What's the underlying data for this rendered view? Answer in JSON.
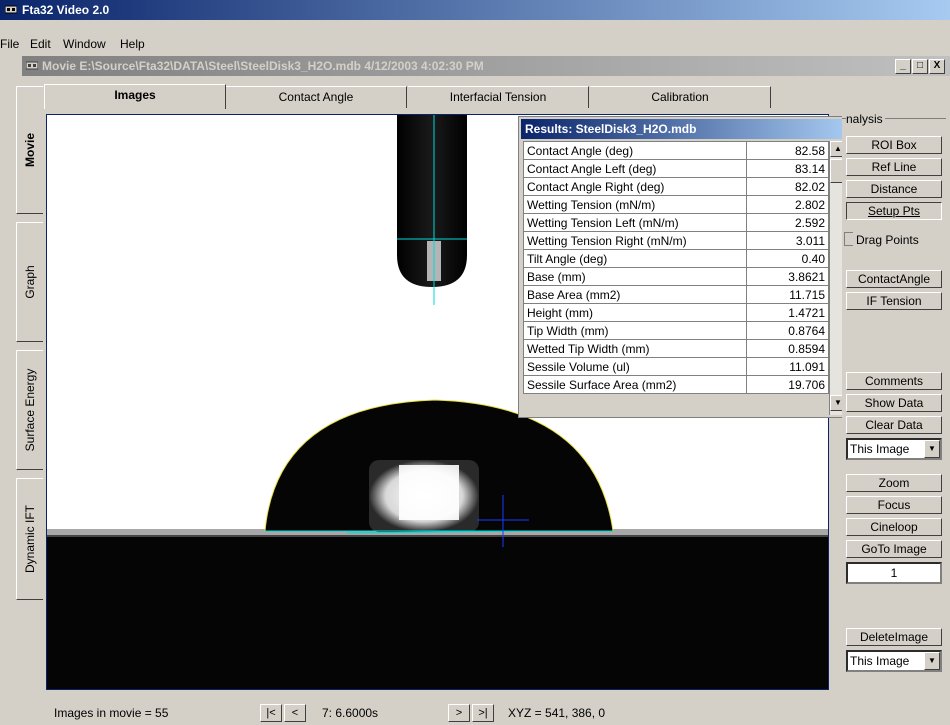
{
  "app": {
    "title": "Fta32 Video 2.0"
  },
  "menu": [
    "File",
    "Edit",
    "Window",
    "Help"
  ],
  "child_window": {
    "title": "Movie E:\\Source\\Fta32\\DATA\\Steel\\SteelDisk3_H2O.mdb 4/12/2003 4:02:30 PM",
    "minimize": "_",
    "restore": "□",
    "close": "X"
  },
  "left_tabs": [
    "Movie",
    "Graph",
    "Surface Energy",
    "Dynamic IFT"
  ],
  "top_tabs": [
    "Images",
    "Contact Angle",
    "Interfacial Tension",
    "Calibration"
  ],
  "results": {
    "title": "Results: SteelDisk3_H2O.mdb",
    "rows": [
      {
        "label": "Contact Angle (deg)",
        "value": "82.58"
      },
      {
        "label": "Contact Angle Left (deg)",
        "value": "83.14"
      },
      {
        "label": "Contact Angle Right (deg)",
        "value": "82.02"
      },
      {
        "label": "Wetting Tension (mN/m)",
        "value": "2.802"
      },
      {
        "label": "Wetting Tension Left (mN/m)",
        "value": "2.592"
      },
      {
        "label": "Wetting Tension Right (mN/m)",
        "value": "3.011"
      },
      {
        "label": "Tilt Angle (deg)",
        "value": "0.40"
      },
      {
        "label": "Base (mm)",
        "value": "3.8621"
      },
      {
        "label": "Base Area (mm2)",
        "value": "11.715"
      },
      {
        "label": "Height (mm)",
        "value": "1.4721"
      },
      {
        "label": "Tip Width (mm)",
        "value": "0.8764"
      },
      {
        "label": "Wetted Tip Width (mm)",
        "value": "0.8594"
      },
      {
        "label": "Sessile Volume (ul)",
        "value": "11.091"
      },
      {
        "label": "Sessile Surface Area (mm2)",
        "value": "19.706"
      }
    ]
  },
  "analysis": {
    "group_label": "nalysis",
    "roi_box": "ROI Box",
    "ref_line": "Ref Line",
    "distance": "Distance",
    "setup_pts": "Setup Pts",
    "drag_points": "Drag Points",
    "contact_angle": "ContactAngle",
    "if_tension": "IF Tension",
    "comments": "Comments",
    "show_data": "Show Data",
    "clear_data": "Clear Data",
    "scope_1": "This Image",
    "zoom": "Zoom",
    "focus": "Focus",
    "cineloop": "Cineloop",
    "goto_image": "GoTo Image",
    "goto_value": "1",
    "delete_image": "DeleteImage",
    "scope_2": "This Image"
  },
  "status": {
    "images_in_movie": "Images in movie = 55",
    "first": "|<",
    "prev": "<",
    "frame": "7:  6.6000s",
    "next": ">",
    "last": ">|",
    "xyz": "XYZ = 541, 386, 0"
  }
}
